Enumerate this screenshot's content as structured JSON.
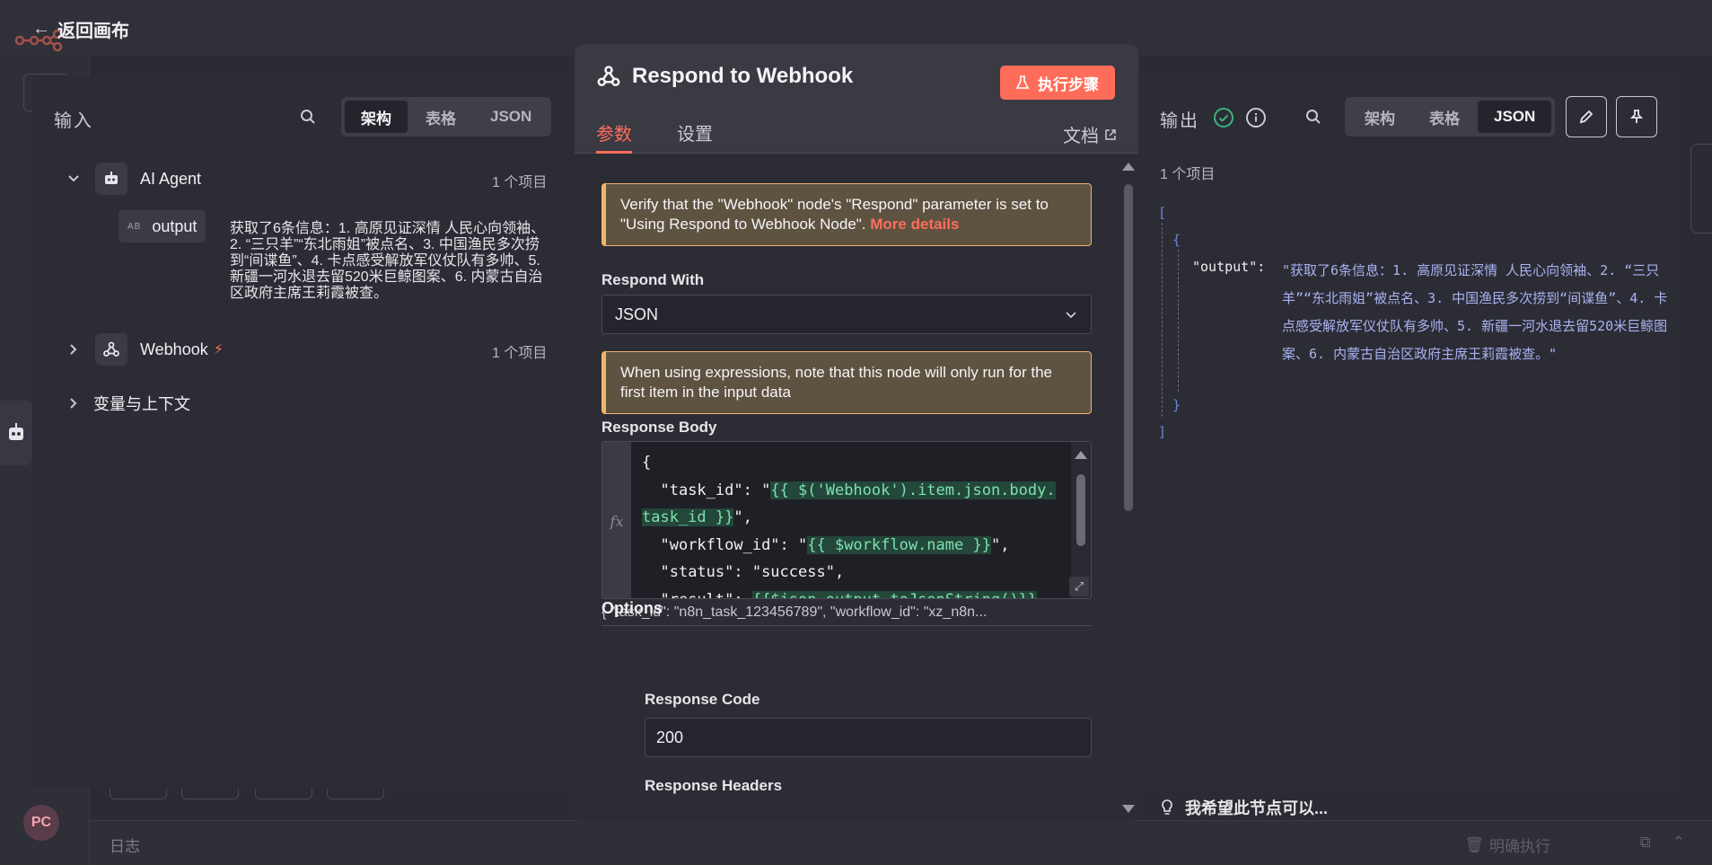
{
  "back": {
    "label": "返回画布"
  },
  "bottom_bar": {
    "log": "日志",
    "clear_run": "明确执行",
    "avatar": "PC"
  },
  "input_panel": {
    "title": "输入",
    "tabs": [
      "架构",
      "表格",
      "JSON"
    ],
    "active_tab": "架构",
    "nodes": [
      {
        "name": "AI Agent",
        "count": "1 个项目",
        "expanded": true,
        "field": {
          "type": "AB",
          "name": "output",
          "value": "获取了6条信息：1. 高原见证深情 人民心向领袖、2. “三只羊”“东北雨姐”被点名、3. 中国渔民多次捞到“间谍鱼”、4. 卡点感受解放军仪仗队有多帅、5. 新疆一河水退去留520米巨鲸图案、6. 内蒙古自治区政府主席王莉霞被查。"
        }
      },
      {
        "name": "Webhook",
        "count": "1 个项目",
        "expanded": false
      }
    ],
    "context": "变量与上下文"
  },
  "center": {
    "title": "Respond to Webhook",
    "exec_button": "执行步骤",
    "tabs": {
      "params": "参数",
      "settings": "设置"
    },
    "docs": "文档",
    "notice1": {
      "text": "Verify that the \"Webhook\" node's \"Respond\" parameter is set to \"Using Respond to Webhook Node\".",
      "more": "More details"
    },
    "respond_with": {
      "label": "Respond With",
      "value": "JSON"
    },
    "notice2": "When using expressions, note that this node will only run for the first item in the input data",
    "response_body": {
      "label": "Response Body",
      "line1": "{",
      "line2_a": "  \"task_id\": \"",
      "line2_expr": "{{ $('Webhook').item.json.body.task_id }}",
      "line2_b": "\",",
      "line3_a": "  \"workflow_id\": \"",
      "line3_expr": "{{ $workflow.name }}",
      "line3_b": "\",",
      "line4": "  \"status\": \"success\",",
      "line5_a": "  \"result\": ",
      "line5_expr": "{{$json.output.toJsonString()}}"
    },
    "preview": "{   \"task_id\": \"n8n_task_123456789\",   \"workflow_id\": \"xz_n8n...",
    "options": {
      "label": "Options",
      "response_code": {
        "label": "Response Code",
        "value": "200"
      },
      "response_headers": {
        "label": "Response Headers"
      }
    }
  },
  "output_panel": {
    "title": "输出",
    "tabs": [
      "架构",
      "表格",
      "JSON"
    ],
    "active_tab": "JSON",
    "count": "1 个项目",
    "json": {
      "open_bracket": "[",
      "open_brace": "{",
      "key": "\"output\":",
      "value": "\"获取了6条信息：1. 高原见证深情 人民心向领袖、2. “三只羊”“东北雨姐”被点名、3. 中国渔民多次捞到“间谍鱼”、4. 卡点感受解放军仪仗队有多帅、5. 新疆一河水退去留520米巨鲸图案、6. 内蒙古自治区政府主席王莉霞被查。\"",
      "close_brace": "}",
      "close_bracket": "]"
    },
    "hint": "我希望此节点可以..."
  },
  "colors": {
    "accent": "#ff6d5a",
    "success": "#3fb27f",
    "expression": "#7fe0b0"
  }
}
